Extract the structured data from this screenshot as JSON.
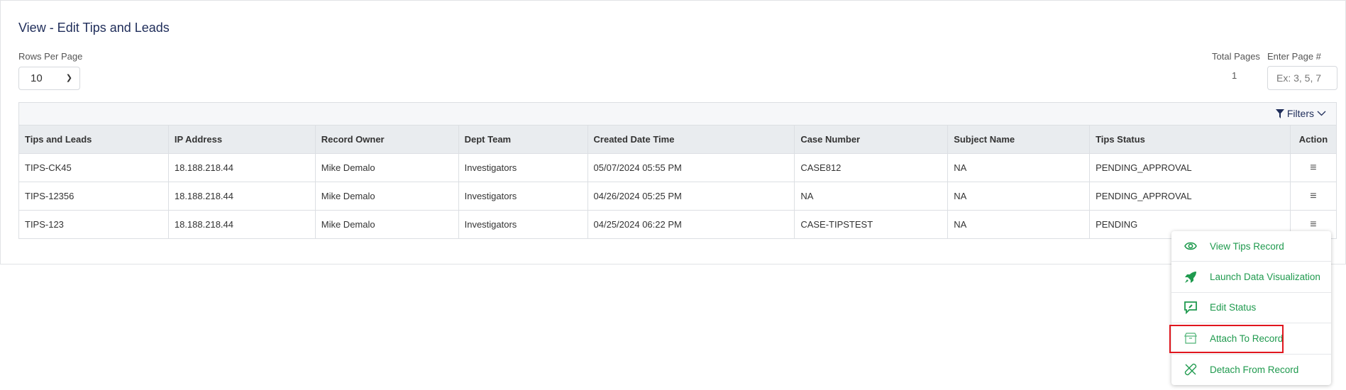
{
  "page": {
    "title": "View - Edit Tips and Leads"
  },
  "pagination": {
    "rows_per_page_label": "Rows Per Page",
    "rows_per_page_value": "10",
    "total_pages_label": "Total Pages",
    "total_pages_value": "1",
    "enter_page_label": "Enter Page #",
    "enter_page_placeholder": "Ex: 3, 5, 7"
  },
  "toolbar": {
    "filters_label": "Filters"
  },
  "table": {
    "headers": [
      "Tips and Leads",
      "IP Address",
      "Record Owner",
      "Dept Team",
      "Created Date Time",
      "Case Number",
      "Subject Name",
      "Tips Status",
      "Action"
    ],
    "rows": [
      [
        "TIPS-CK45",
        "18.188.218.44",
        "Mike Demalo",
        "Investigators",
        "05/07/2024 05:55 PM",
        "CASE812",
        "NA",
        "PENDING_APPROVAL"
      ],
      [
        "TIPS-12356",
        "18.188.218.44",
        "Mike Demalo",
        "Investigators",
        "04/26/2024 05:25 PM",
        "NA",
        "NA",
        "PENDING_APPROVAL"
      ],
      [
        "TIPS-123",
        "18.188.218.44",
        "Mike Demalo",
        "Investigators",
        "04/25/2024 06:22 PM",
        "CASE-TIPSTEST",
        "NA",
        "PENDING"
      ]
    ]
  },
  "action_menu": {
    "accent": "#1f9a4e",
    "highlight_color": "#e0161e",
    "items": [
      {
        "label": "View Tips Record",
        "icon": "eye-icon"
      },
      {
        "label": "Launch Data Visualization",
        "icon": "rocket-icon"
      },
      {
        "label": "Edit Status",
        "icon": "edit-comment-icon"
      },
      {
        "label": "Attach To Record",
        "icon": "archive-box-icon",
        "highlighted": true
      },
      {
        "label": "Detach From Record",
        "icon": "unlink-icon"
      }
    ]
  }
}
